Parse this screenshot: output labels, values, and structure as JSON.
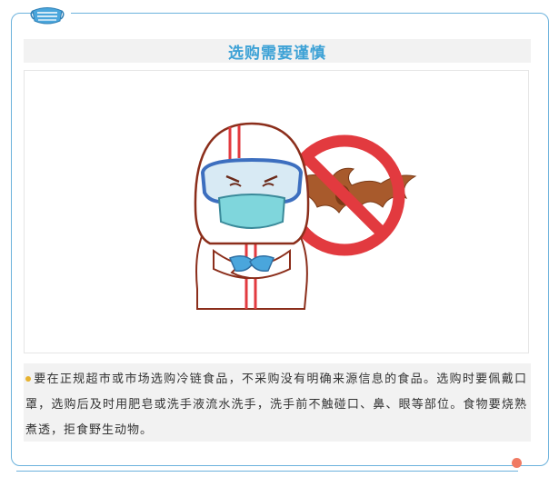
{
  "section": {
    "title": "选购需要谨慎",
    "body": "要在正规超市或市场选购冷链食品，不采购没有明确来源信息的食品。选购时要佩戴口罩，选购后及时用肥皂或洗手液流水洗手，洗手前不触碰口、鼻、眼等部位。食物要烧熟煮透，拒食野生动物。"
  },
  "icons": {
    "header": "face-mask-icon",
    "illustration": "protective-suit-worker-with-no-bat-sign",
    "bullet": "bullet-dot-icon"
  },
  "colors": {
    "frame": "#6cb2dc",
    "title": "#3ea2d6",
    "panel_bg": "#f2f2f2",
    "body_text": "#333333",
    "bullet": "#e7b22f",
    "corner_dot": "#f07a63",
    "no_sign": "#e23a3f",
    "bat": "#a85a2c"
  }
}
